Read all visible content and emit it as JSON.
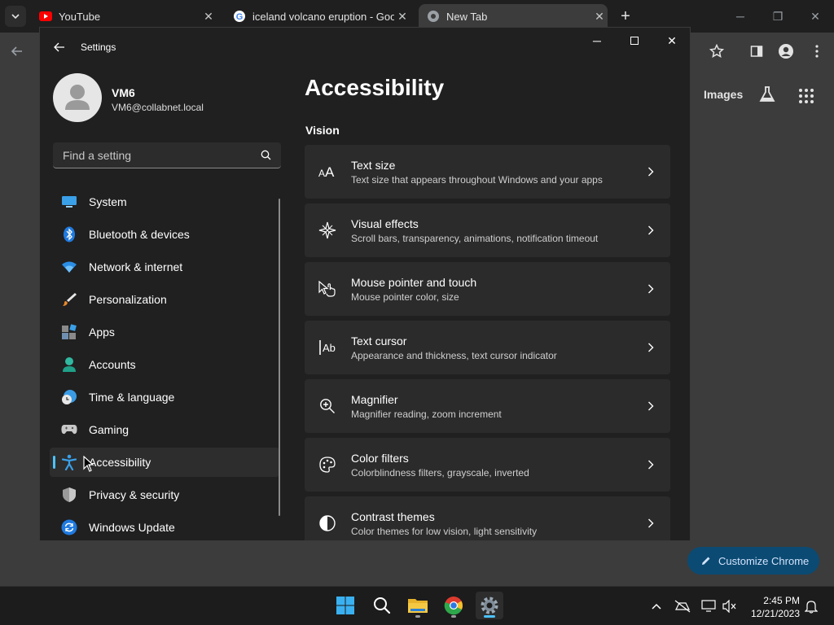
{
  "chrome": {
    "tabs": [
      {
        "title": "YouTube",
        "active": false
      },
      {
        "title": "iceland volcano eruption - Goo",
        "active": false
      },
      {
        "title": "New Tab",
        "active": true
      }
    ],
    "ntp": {
      "images_link": "Images",
      "customize_button": "Customize Chrome"
    }
  },
  "settings": {
    "window_title": "Settings",
    "user": {
      "name": "VM6",
      "email": "VM6@collabnet.local"
    },
    "search_placeholder": "Find a setting",
    "nav": [
      {
        "label": "System",
        "icon": "monitor-icon"
      },
      {
        "label": "Bluetooth & devices",
        "icon": "bluetooth-icon"
      },
      {
        "label": "Network & internet",
        "icon": "wifi-icon"
      },
      {
        "label": "Personalization",
        "icon": "brush-icon"
      },
      {
        "label": "Apps",
        "icon": "apps-icon"
      },
      {
        "label": "Accounts",
        "icon": "person-icon"
      },
      {
        "label": "Time & language",
        "icon": "globe-clock-icon"
      },
      {
        "label": "Gaming",
        "icon": "gamepad-icon"
      },
      {
        "label": "Accessibility",
        "icon": "accessibility-icon",
        "selected": true
      },
      {
        "label": "Privacy & security",
        "icon": "shield-icon"
      },
      {
        "label": "Windows Update",
        "icon": "refresh-icon"
      }
    ],
    "page_title": "Accessibility",
    "section": "Vision",
    "cards": [
      {
        "title": "Text size",
        "desc": "Text size that appears throughout Windows and your apps",
        "icon": "text-size-icon"
      },
      {
        "title": "Visual effects",
        "desc": "Scroll bars, transparency, animations, notification timeout",
        "icon": "sparkle-icon"
      },
      {
        "title": "Mouse pointer and touch",
        "desc": "Mouse pointer color, size",
        "icon": "pointer-touch-icon"
      },
      {
        "title": "Text cursor",
        "desc": "Appearance and thickness, text cursor indicator",
        "icon": "text-cursor-icon"
      },
      {
        "title": "Magnifier",
        "desc": "Magnifier reading, zoom increment",
        "icon": "magnifier-icon"
      },
      {
        "title": "Color filters",
        "desc": "Colorblindness filters, grayscale, inverted",
        "icon": "palette-icon"
      },
      {
        "title": "Contrast themes",
        "desc": "Color themes for low vision, light sensitivity",
        "icon": "contrast-icon"
      }
    ]
  },
  "taskbar": {
    "time": "2:45 PM",
    "date": "12/21/2023"
  },
  "colors": {
    "accent": "#4cc2ff",
    "window_bg": "#202020",
    "card_bg": "#2b2b2b"
  }
}
